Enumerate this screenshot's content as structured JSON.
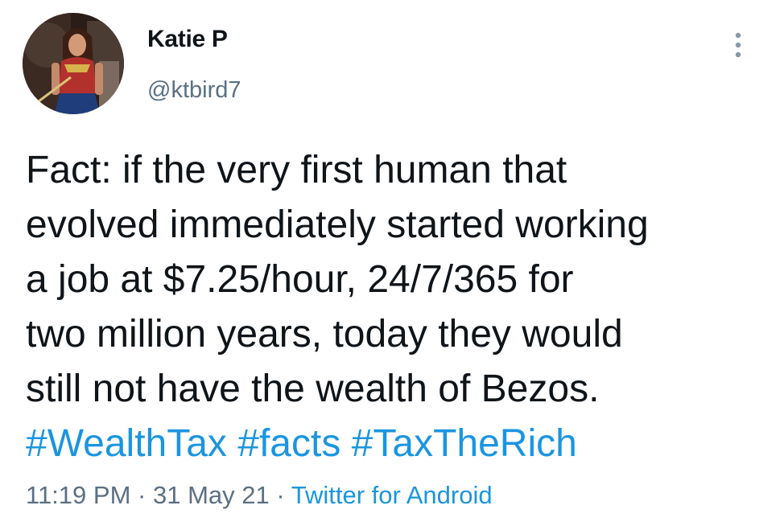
{
  "author": {
    "display_name": "Katie P",
    "handle": "@ktbird7",
    "avatar_icon": "avatar-photo-icon"
  },
  "tweet": {
    "lines": [
      "Fact: if the very first human that",
      "evolved immediately started working",
      "a job at $7.25/hour, 24/7/365 for",
      "two million years, today they would",
      "still not have the wealth of Bezos."
    ],
    "hashtags": [
      "#WealthTax",
      "#facts",
      "#TaxTheRich"
    ]
  },
  "meta": {
    "time": "11:19 PM",
    "separator": "·",
    "date": "31 May 21",
    "source": "Twitter for Android"
  },
  "menu": {
    "icon": "more-vertical-icon"
  },
  "colors": {
    "text": "#0f1419",
    "secondary": "#5b7083",
    "link": "#1b95e0"
  }
}
